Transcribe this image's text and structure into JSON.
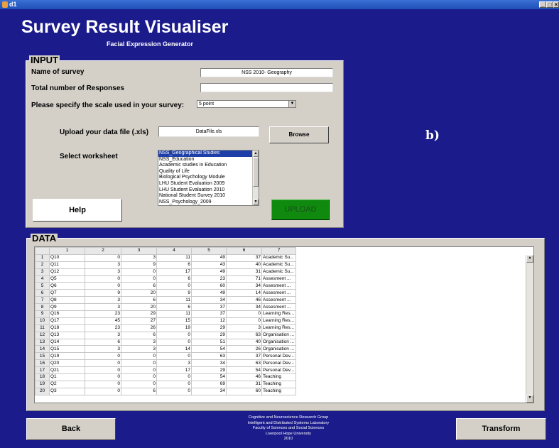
{
  "window": {
    "title": "d1",
    "controls": [
      "_",
      "□",
      "×"
    ]
  },
  "header": {
    "title": "Survey Result Visualiser",
    "subtitle": "Facial Expression Generator",
    "annotation": "b)"
  },
  "input_panel": {
    "title": "INPUT",
    "survey_name_label": "Name of survey",
    "survey_name_value": "NSS 2010- Geography",
    "responses_label": "Total number of Responses",
    "responses_value": "",
    "scale_label": "Please specify the scale used in your survey:",
    "scale_value": "5 point",
    "upload_label": "Upload your data file (.xls)",
    "file_value": "DataFile.xls",
    "browse_label": "Browse",
    "worksheet_label": "Select worksheet",
    "worksheets": [
      "NSS_Geographical Studies",
      "NSS_Education",
      "Academic studies in Education",
      "Quality of Life",
      "Biological Psychology Module",
      "LHU Student Evaluation 2009",
      "LHU Student Evaluation 2010",
      "National Student Survey 2010",
      "NSS_Psychology_2009"
    ],
    "selected_worksheet": 0,
    "help_label": "Help",
    "upload_button_label": "UPLOAD"
  },
  "data_panel": {
    "title": "DATA",
    "columns": [
      "",
      "1",
      "2",
      "3",
      "4",
      "5",
      "6",
      "7"
    ],
    "rows": [
      [
        "1",
        "Q10",
        "0",
        "3",
        "11",
        "49",
        "37",
        "Academic Su..."
      ],
      [
        "2",
        "Q11",
        "3",
        "9",
        "6",
        "43",
        "40",
        "Academic Su..."
      ],
      [
        "3",
        "Q12",
        "3",
        "0",
        "17",
        "49",
        "31",
        "Academic Su..."
      ],
      [
        "4",
        "Q5",
        "0",
        "0",
        "6",
        "23",
        "71",
        "Assesment ..."
      ],
      [
        "5",
        "Q6",
        "0",
        "6",
        "0",
        "60",
        "34",
        "Assesment ..."
      ],
      [
        "6",
        "Q7",
        "9",
        "20",
        "9",
        "49",
        "14",
        "Assesment ..."
      ],
      [
        "7",
        "Q8",
        "3",
        "6",
        "11",
        "34",
        "46",
        "Assesment ..."
      ],
      [
        "8",
        "Q9",
        "3",
        "20",
        "6",
        "37",
        "34",
        "Assesment ..."
      ],
      [
        "9",
        "Q16",
        "23",
        "29",
        "11",
        "37",
        "0",
        "Learning Res..."
      ],
      [
        "10",
        "Q17",
        "45",
        "27",
        "15",
        "12",
        "0",
        "Learning Res..."
      ],
      [
        "11",
        "Q18",
        "23",
        "26",
        "19",
        "29",
        "3",
        "Learning Res..."
      ],
      [
        "12",
        "Q13",
        "3",
        "6",
        "0",
        "29",
        "63",
        "Organisation ..."
      ],
      [
        "13",
        "Q14",
        "6",
        "3",
        "0",
        "51",
        "40",
        "Organisation ..."
      ],
      [
        "14",
        "Q15",
        "3",
        "3",
        "14",
        "54",
        "26",
        "Organisation ..."
      ],
      [
        "15",
        "Q19",
        "0",
        "0",
        "0",
        "63",
        "37",
        "Personal Dev..."
      ],
      [
        "16",
        "Q20",
        "0",
        "0",
        "3",
        "34",
        "63",
        "Personal Dev..."
      ],
      [
        "17",
        "Q21",
        "0",
        "0",
        "17",
        "29",
        "54",
        "Personal Dev..."
      ],
      [
        "18",
        "Q1",
        "0",
        "0",
        "0",
        "54",
        "46",
        "Teaching"
      ],
      [
        "19",
        "Q2",
        "0",
        "0",
        "0",
        "69",
        "31",
        "Teaching"
      ],
      [
        "20",
        "Q3",
        "0",
        "6",
        "0",
        "34",
        "60",
        "Teaching"
      ]
    ]
  },
  "footer": {
    "lines": [
      "Cognitive and Neuroscience Research Group",
      "Intelligent and Distributed Systems Laboratory",
      "Faculty of Sciences and Social Sciences",
      "Liverpool Hope University",
      "2010"
    ],
    "back_label": "Back",
    "transform_label": "Transform"
  }
}
